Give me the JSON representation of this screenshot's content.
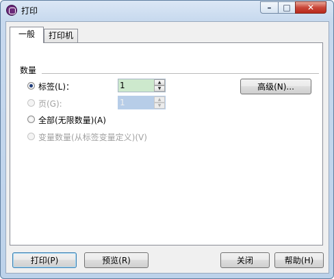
{
  "window": {
    "title": "打印"
  },
  "tabs": [
    {
      "label": "一般",
      "active": true
    },
    {
      "label": "打印机",
      "active": false
    }
  ],
  "quantity": {
    "group_label": "数量",
    "options": [
      {
        "label": "标签(L)：",
        "checked": true,
        "disabled": false
      },
      {
        "label": "页(G):",
        "checked": false,
        "disabled": true
      },
      {
        "label": "全部(无限数量)(A)",
        "checked": false,
        "disabled": false
      },
      {
        "label": "变量数量(从标签变量定义)(V)",
        "checked": false,
        "disabled": true
      }
    ],
    "labels_value": "1",
    "pages_value": "1"
  },
  "buttons": {
    "advanced": "高级(N)...",
    "print": "打印(P)",
    "preview": "预览(R)",
    "close": "关闭",
    "help": "帮助(H)"
  },
  "icons": {
    "app": "printer-app-icon",
    "minimize": "minimize-icon",
    "maximize": "maximize-icon",
    "close": "close-icon"
  }
}
